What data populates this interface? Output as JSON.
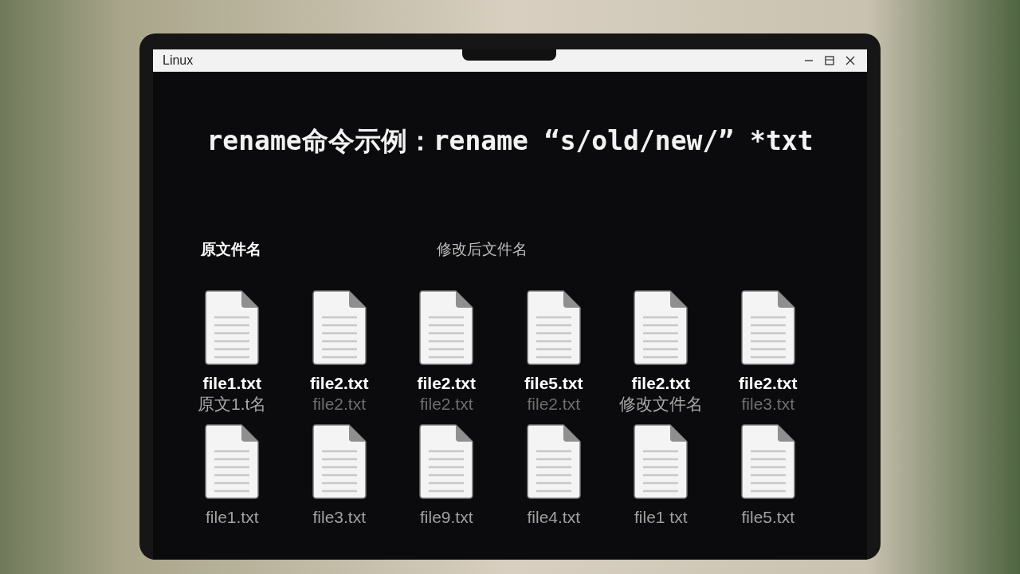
{
  "window": {
    "title": "Linux"
  },
  "heading": "rename命令示例：rename “s/old/new/” *txt",
  "column_labels": [
    {
      "text": "原文件名",
      "dimmed": false
    },
    {
      "text": "修改后文件名",
      "dimmed": true
    }
  ],
  "rows": [
    {
      "files": [
        {
          "name": "file1.txt",
          "dimmed": false,
          "caption": "原文1.t名",
          "caption_dimmed": false
        },
        {
          "name": "file2.txt",
          "dimmed": false,
          "caption": "file2.txt",
          "caption_dimmed": true
        },
        {
          "name": "file2.txt",
          "dimmed": false,
          "caption": "file2.txt",
          "caption_dimmed": true
        },
        {
          "name": "file5.txt",
          "dimmed": false,
          "caption": "file2.txt",
          "caption_dimmed": true
        },
        {
          "name": "file2.txt",
          "dimmed": false,
          "caption": "修改文件名",
          "caption_dimmed": false
        },
        {
          "name": "file2.txt",
          "dimmed": false,
          "caption": "file3.txt",
          "caption_dimmed": true
        }
      ]
    },
    {
      "files": [
        {
          "name": "file1.txt",
          "dimmed": true
        },
        {
          "name": "file3.txt",
          "dimmed": true
        },
        {
          "name": "file9.txt",
          "dimmed": true
        },
        {
          "name": "file4.txt",
          "dimmed": true
        },
        {
          "name": "file1 txt",
          "dimmed": true
        },
        {
          "name": "file5.txt",
          "dimmed": true
        }
      ]
    }
  ]
}
